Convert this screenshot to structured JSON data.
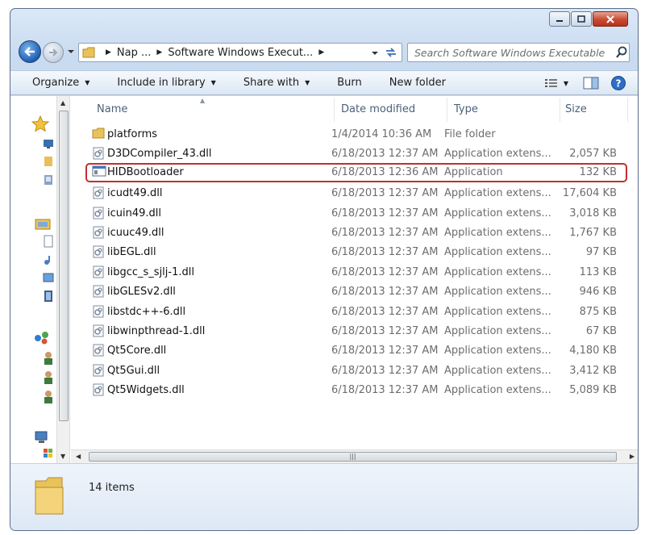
{
  "address": {
    "crumbs": [
      "Nap ...",
      "Software Windows Execut..."
    ]
  },
  "search": {
    "placeholder": "Search Software Windows Executable"
  },
  "toolbar": {
    "organize": "Organize",
    "include_in_library": "Include in library",
    "share_with": "Share with",
    "burn": "Burn",
    "new_folder": "New folder"
  },
  "columns": {
    "name": "Name",
    "date": "Date modified",
    "type": "Type",
    "size": "Size"
  },
  "files": [
    {
      "name": "platforms",
      "date": "1/4/2014 10:36 AM",
      "type": "File folder",
      "size": "",
      "icon": "folder-icon"
    },
    {
      "name": "D3DCompiler_43.dll",
      "date": "6/18/2013 12:37 AM",
      "type": "Application extens...",
      "size": "2,057 KB",
      "icon": "dll-icon"
    },
    {
      "name": "HIDBootloader",
      "date": "6/18/2013 12:36 AM",
      "type": "Application",
      "size": "132 KB",
      "icon": "application-icon"
    },
    {
      "name": "icudt49.dll",
      "date": "6/18/2013 12:37 AM",
      "type": "Application extens...",
      "size": "17,604 KB",
      "icon": "dll-icon"
    },
    {
      "name": "icuin49.dll",
      "date": "6/18/2013 12:37 AM",
      "type": "Application extens...",
      "size": "3,018 KB",
      "icon": "dll-icon"
    },
    {
      "name": "icuuc49.dll",
      "date": "6/18/2013 12:37 AM",
      "type": "Application extens...",
      "size": "1,767 KB",
      "icon": "dll-icon"
    },
    {
      "name": "libEGL.dll",
      "date": "6/18/2013 12:37 AM",
      "type": "Application extens...",
      "size": "97 KB",
      "icon": "dll-icon"
    },
    {
      "name": "libgcc_s_sjlj-1.dll",
      "date": "6/18/2013 12:37 AM",
      "type": "Application extens...",
      "size": "113 KB",
      "icon": "dll-icon"
    },
    {
      "name": "libGLESv2.dll",
      "date": "6/18/2013 12:37 AM",
      "type": "Application extens...",
      "size": "946 KB",
      "icon": "dll-icon"
    },
    {
      "name": "libstdc++-6.dll",
      "date": "6/18/2013 12:37 AM",
      "type": "Application extens...",
      "size": "875 KB",
      "icon": "dll-icon"
    },
    {
      "name": "libwinpthread-1.dll",
      "date": "6/18/2013 12:37 AM",
      "type": "Application extens...",
      "size": "67 KB",
      "icon": "dll-icon"
    },
    {
      "name": "Qt5Core.dll",
      "date": "6/18/2013 12:37 AM",
      "type": "Application extens...",
      "size": "4,180 KB",
      "icon": "dll-icon"
    },
    {
      "name": "Qt5Gui.dll",
      "date": "6/18/2013 12:37 AM",
      "type": "Application extens...",
      "size": "3,412 KB",
      "icon": "dll-icon"
    },
    {
      "name": "Qt5Widgets.dll",
      "date": "6/18/2013 12:37 AM",
      "type": "Application extens...",
      "size": "5,089 KB",
      "icon": "dll-icon"
    }
  ],
  "highlighted_file": "HIDBootloader",
  "status": {
    "item_count": "14 items"
  },
  "colors": {
    "highlight_border": "#c0302f",
    "column_header_text": "#4c607a",
    "secondary_text": "#6d6d6d"
  }
}
